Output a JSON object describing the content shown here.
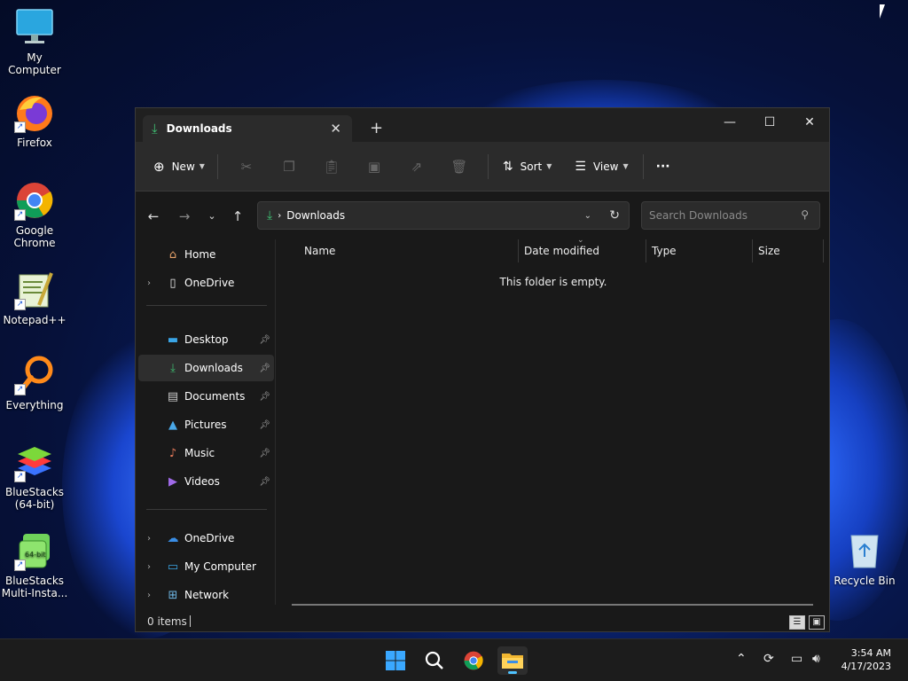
{
  "desktop": {
    "icons": [
      {
        "label": "My Computer"
      },
      {
        "label": "Firefox"
      },
      {
        "label": "Google Chrome"
      },
      {
        "label": "Notepad++"
      },
      {
        "label": "Everything"
      },
      {
        "label": "BlueStacks (64-bit)"
      },
      {
        "label": "BlueStacks Multi-Insta..."
      },
      {
        "label": "Recycle Bin"
      }
    ]
  },
  "explorer": {
    "tab_title": "Downloads",
    "toolbar": {
      "new_label": "New",
      "sort_label": "Sort",
      "view_label": "View",
      "more_label": "···"
    },
    "address": {
      "crumb": "Downloads",
      "search_placeholder": "Search Downloads"
    },
    "nav": {
      "home": "Home",
      "onedrive_top": "OneDrive",
      "desktop": "Desktop",
      "downloads": "Downloads",
      "documents": "Documents",
      "pictures": "Pictures",
      "music": "Music",
      "videos": "Videos",
      "onedrive": "OneDrive",
      "my_computer": "My Computer",
      "network": "Network"
    },
    "columns": {
      "name": "Name",
      "date": "Date modified",
      "type": "Type",
      "size": "Size"
    },
    "empty_message": "This folder is empty.",
    "status": "0 items"
  },
  "taskbar": {
    "time": "3:54 AM",
    "date": "4/17/2023"
  },
  "colors": {
    "accent": "#4fc3ff",
    "download_green": "#3fbf72",
    "window_bg": "#191919"
  }
}
